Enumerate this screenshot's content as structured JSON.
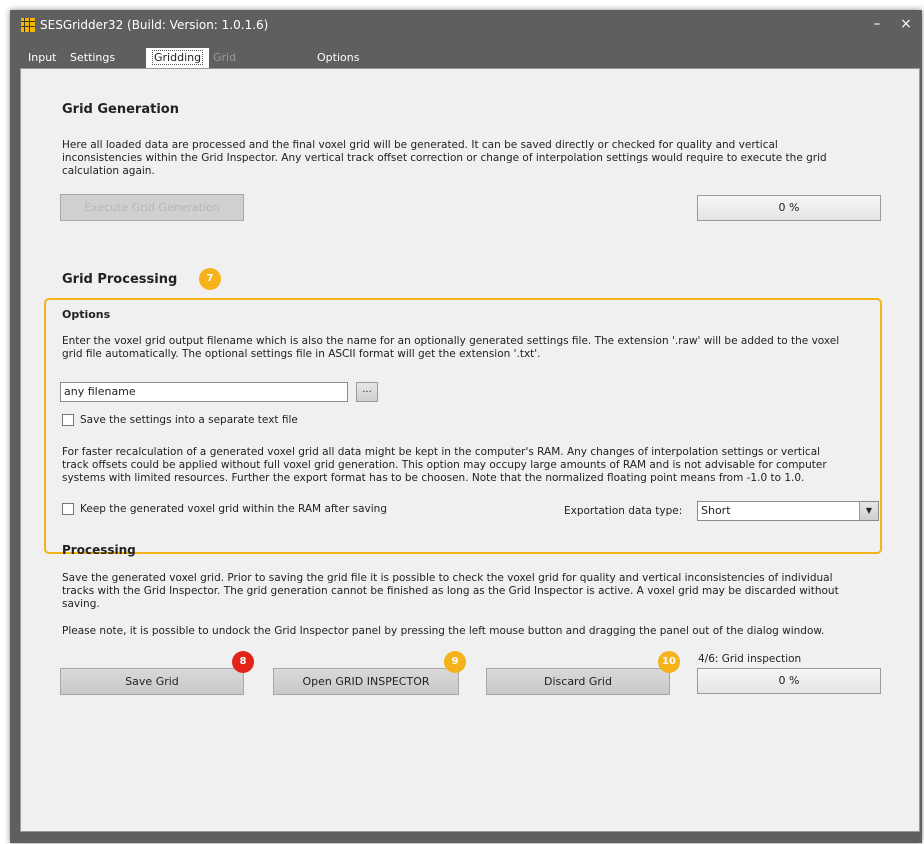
{
  "window": {
    "title": "SESGridder32 (Build: Version: 1.0.1.6)",
    "minimize": "–",
    "close": "×"
  },
  "tabs": [
    {
      "label": "Input"
    },
    {
      "label": "Settings"
    },
    {
      "label": "Gridding"
    },
    {
      "label": "Grid Inspector"
    },
    {
      "label": "Options"
    }
  ],
  "grid_generation": {
    "title": "Grid Generation",
    "line1": "Here all loaded data are processed and the final voxel grid will be generated. It can be saved directly or checked for quality and vertical",
    "line2": "inconsistencies within the Grid Inspector. Any vertical track offset correction or change of interpolation settings would require to execute the grid",
    "line3": "calculation again.",
    "execute_button": "Execute Grid Generation",
    "progress": "0 %"
  },
  "grid_processing": {
    "title": "Grid Processing",
    "badge": "7",
    "options": {
      "title": "Options",
      "desc_line1": "Enter the voxel grid output filename which is also the name for an optionally generated settings file. The extension '.raw' will be added to the voxel",
      "desc_line2": "grid file automatically. The optional settings file in ASCII format will get the extension '.txt'.",
      "filename_value": "any filename",
      "browse_button": "...",
      "save_settings_label": "Save the settings into a separate text file",
      "ram_line1": "For faster recalculation of a generated voxel grid all data might be kept in the computer's RAM. Any changes of interpolation settings or vertical",
      "ram_line2": "track offsets could be applied without full voxel grid generation. This option may occupy large amounts of RAM and is not advisable for computer",
      "ram_line3": "systems with limited resources. Further the export format has to be choosen. Note that the normalized floating point means from -1.0 to 1.0.",
      "keep_ram_label": "Keep the generated voxel grid within the RAM after saving",
      "export_type_label": "Exportation data type:",
      "export_type_value": "Short"
    }
  },
  "processing": {
    "title": "Processing",
    "line1": "Save the generated voxel grid. Prior to saving the grid file it is possible to check the voxel grid for quality and vertical inconsistencies of individual",
    "line2": "tracks with the Grid Inspector. The grid generation cannot be finished as long as the Grid Inspector is active. A voxel grid may be discarded without",
    "line3": "saving.",
    "line4": "Please note, it is possible to undock the Grid Inspector panel by pressing the left mouse button and dragging the panel out of the dialog window.",
    "save_button": "Save Grid",
    "save_badge": "8",
    "inspector_button": "Open GRID INSPECTOR",
    "inspector_badge": "9",
    "discard_button": "Discard Grid",
    "discard_badge": "10",
    "step_label": "4/6: Grid inspection",
    "progress": "0 %"
  },
  "colors": {
    "accent_orange": "#f5b21a",
    "badge_red": "#e2231a",
    "window_chrome": "#5f5f5f"
  }
}
